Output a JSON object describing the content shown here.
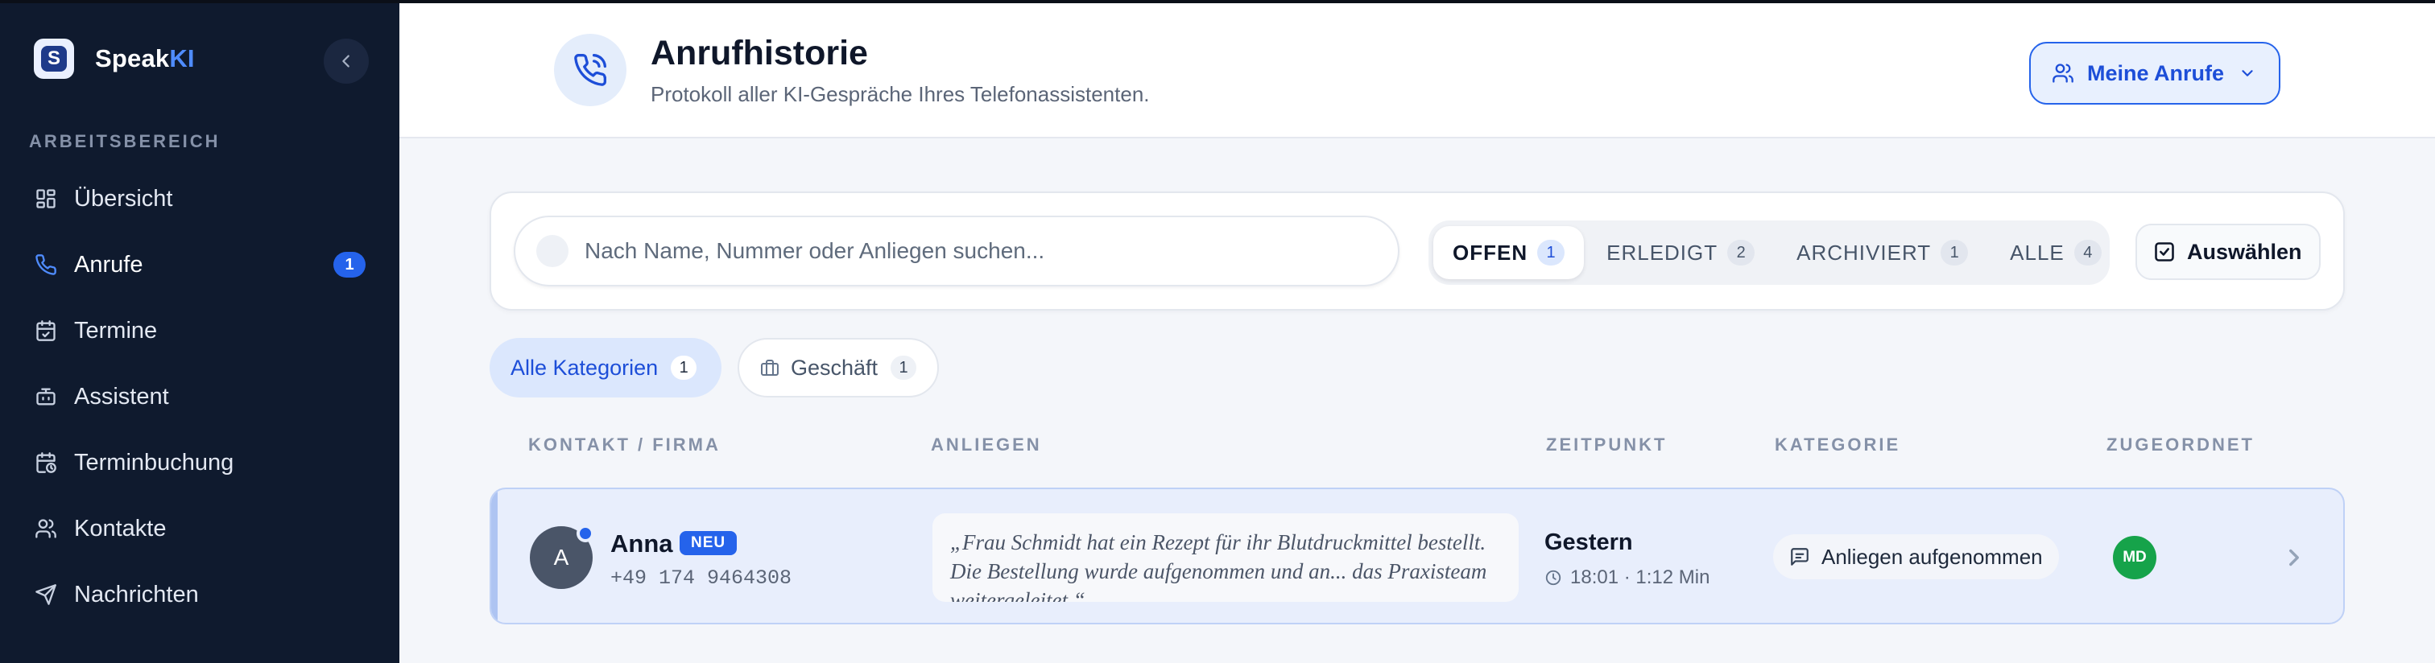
{
  "app": {
    "brand_prefix": "Speak",
    "brand_suffix": "KI",
    "logo_letter": "S"
  },
  "sidebar": {
    "section_label": "ARBEITSBEREICH",
    "items": [
      {
        "label": "Übersicht",
        "icon": "dashboard-icon"
      },
      {
        "label": "Anrufe",
        "icon": "phone-icon",
        "badge": "1",
        "active": true
      },
      {
        "label": "Termine",
        "icon": "calendar-check-icon"
      },
      {
        "label": "Assistent",
        "icon": "bot-icon"
      },
      {
        "label": "Terminbuchung",
        "icon": "calendar-clock-icon"
      },
      {
        "label": "Kontakte",
        "icon": "users-icon"
      },
      {
        "label": "Nachrichten",
        "icon": "send-icon"
      }
    ]
  },
  "header": {
    "title": "Anrufhistorie",
    "subtitle": "Protokoll aller KI-Gespräche Ihres Telefonassistenten.",
    "my_calls_label": "Meine Anrufe"
  },
  "toolbar": {
    "search_placeholder": "Nach Name, Nummer oder Anliegen suchen...",
    "tabs": [
      {
        "label": "OFFEN",
        "count": "1",
        "active": true
      },
      {
        "label": "ERLEDIGT",
        "count": "2"
      },
      {
        "label": "ARCHIVIERT",
        "count": "1"
      },
      {
        "label": "ALLE",
        "count": "4"
      }
    ],
    "select_label": "Auswählen"
  },
  "categories": [
    {
      "label": "Alle Kategorien",
      "count": "1",
      "active": true
    },
    {
      "label": "Geschäft",
      "count": "1",
      "icon": "briefcase-icon"
    }
  ],
  "table": {
    "headers": [
      "KONTAKT / FIRMA",
      "ANLIEGEN",
      "ZEITPUNKT",
      "KATEGORIE",
      "ZUGEORDNET"
    ],
    "rows": [
      {
        "avatar": "A",
        "name": "Anna",
        "badge": "NEU",
        "phone": "+49 174 9464308",
        "concern": "„Frau Schmidt hat ein Rezept für ihr Blutdruckmittel bestellt. Die Bestellung wurde aufgenommen und an... das Praxisteam weitergeleitet.“",
        "when": "Gestern",
        "when_detail": "18:01 · 1:12 Min",
        "category": "Anliegen aufgenommen",
        "assignee": "MD"
      }
    ]
  },
  "colors": {
    "sidebar_bg": "#0f1a2e",
    "accent": "#2563eb",
    "row_bg": "#e8eefc",
    "assignee": "#16a34a"
  }
}
